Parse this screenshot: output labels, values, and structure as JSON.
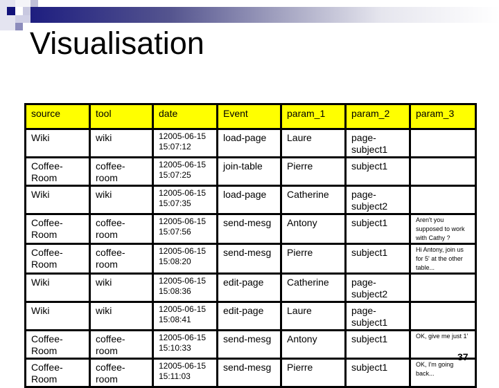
{
  "slide": {
    "title": "Visualisation",
    "page_number": "37",
    "accent_colors": {
      "header_fill": "#ffff00",
      "banner_dark": "#1e1e80"
    }
  },
  "table": {
    "columns": [
      "source",
      "tool",
      "date",
      "Event",
      "param_1",
      "param_2",
      "param_3"
    ],
    "rows": [
      {
        "source": "Wiki",
        "tool": "wiki",
        "date": "12005-06-15 15:07:12",
        "event": "load-page",
        "param_1": "Laure",
        "param_2": "page-subject1",
        "param_3": ""
      },
      {
        "source": "Coffee-Room",
        "tool": "coffee-room",
        "date": "12005-06-15 15:07:25",
        "event": "join-table",
        "param_1": "Pierre",
        "param_2": "subject1",
        "param_3": ""
      },
      {
        "source": "Wiki",
        "tool": "wiki",
        "date": "12005-06-15 15:07:35",
        "event": "load-page",
        "param_1": "Catherine",
        "param_2": "page-subject2",
        "param_3": ""
      },
      {
        "source": "Coffee-Room",
        "tool": "coffee-room",
        "date": "12005-06-15 15:07:56",
        "event": "send-mesg",
        "param_1": "Antony",
        "param_2": "subject1",
        "param_3": "Aren't you supposed to work with Cathy ?"
      },
      {
        "source": "Coffee-Room",
        "tool": "coffee-room",
        "date": "12005-06-15 15:08:20",
        "event": "send-mesg",
        "param_1": "Pierre",
        "param_2": "subject1",
        "param_3": "Hi Antony, join us for 5' at the other table..."
      },
      {
        "source": "Wiki",
        "tool": "wiki",
        "date": "12005-06-15 15:08:36",
        "event": "edit-page",
        "param_1": "Catherine",
        "param_2": "page-subject2",
        "param_3": ""
      },
      {
        "source": "Wiki",
        "tool": "wiki",
        "date": "12005-06-15 15:08:41",
        "event": "edit-page",
        "param_1": "Laure",
        "param_2": "page-subject1",
        "param_3": ""
      },
      {
        "source": "Coffee-Room",
        "tool": "coffee-room",
        "date": "12005-06-15 15:10:33",
        "event": "send-mesg",
        "param_1": "Antony",
        "param_2": "subject1",
        "param_3": "OK, give me just 1'"
      },
      {
        "source": "Coffee-Room",
        "tool": "coffee-room",
        "date": "12005-06-15 15:11:03",
        "event": "send-mesg",
        "param_1": "Pierre",
        "param_2": "subject1",
        "param_3": "OK, I'm going back..."
      }
    ]
  }
}
